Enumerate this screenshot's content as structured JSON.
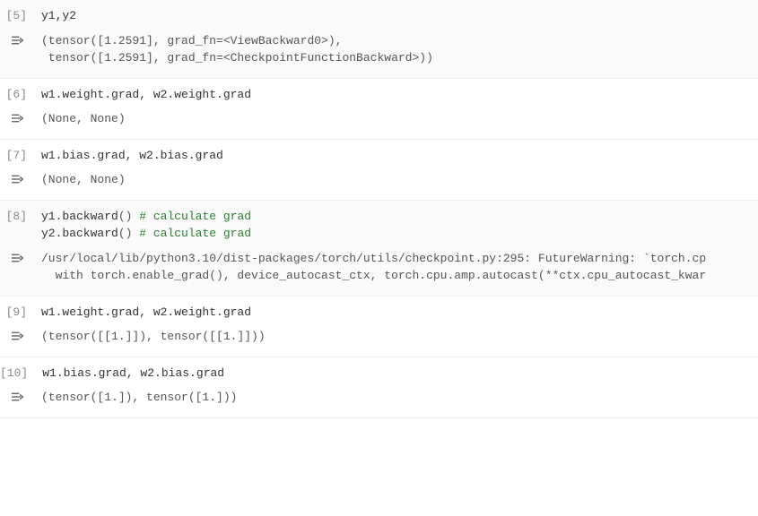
{
  "cells": [
    {
      "prompt": "[5]",
      "code": "y1,y2",
      "output": "(tensor([1.2591], grad_fn=<ViewBackward0>),\n tensor([1.2591], grad_fn=<CheckpointFunctionBackward>))"
    },
    {
      "prompt": "[6]",
      "code": "w1.weight.grad, w2.weight.grad",
      "output": "(None, None)"
    },
    {
      "prompt": "[7]",
      "code": "w1.bias.grad, w2.bias.grad",
      "output": "(None, None)"
    },
    {
      "prompt": "[8]",
      "code_html": "y1.backward<span class=\"paren\">()</span> <span class=\"comment\"># calculate grad</span>\ny2.backward<span class=\"paren\">()</span> <span class=\"comment\"># calculate grad</span>",
      "output": "/usr/local/lib/python3.10/dist-packages/torch/utils/checkpoint.py:295: FutureWarning: `torch.cp\n  with torch.enable_grad(), device_autocast_ctx, torch.cpu.amp.autocast(**ctx.cpu_autocast_kwar"
    },
    {
      "prompt": "[9]",
      "code": "w1.weight.grad, w2.weight.grad",
      "output": "(tensor([[1.]]), tensor([[1.]]))"
    },
    {
      "prompt": "[10]",
      "code": "w1.bias.grad, w2.bias.grad",
      "output": "(tensor([1.]), tensor([1.]))"
    }
  ]
}
